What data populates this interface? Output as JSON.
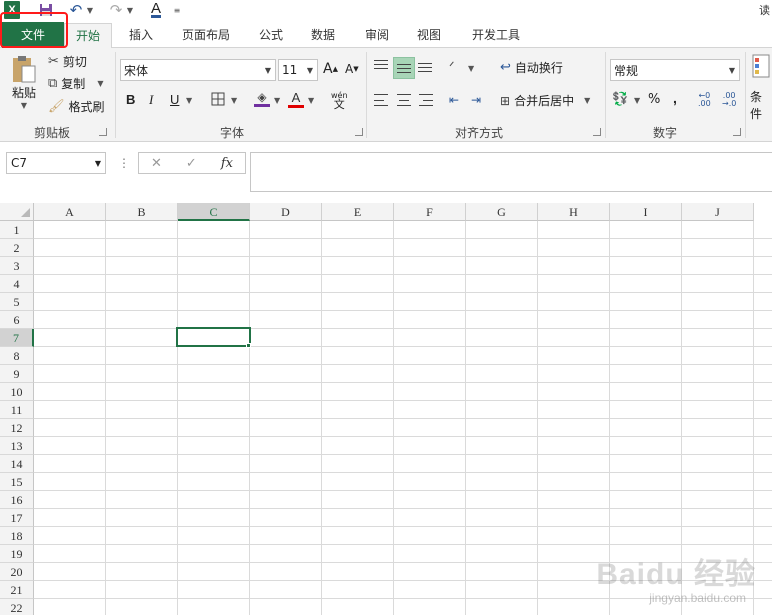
{
  "title_tail": "读",
  "tabs": [
    {
      "label": "文件"
    },
    {
      "label": "开始"
    },
    {
      "label": "插入"
    },
    {
      "label": "页面布局"
    },
    {
      "label": "公式"
    },
    {
      "label": "数据"
    },
    {
      "label": "审阅"
    },
    {
      "label": "视图"
    },
    {
      "label": "开发工具"
    }
  ],
  "clipboard": {
    "paste": "粘贴",
    "cut": "剪切",
    "copy": "复制",
    "format_painter": "格式刷",
    "group": "剪贴板"
  },
  "font": {
    "name": "宋体",
    "size": "11",
    "phonetic": "wén",
    "group": "字体"
  },
  "alignment": {
    "wrap_text": "自动换行",
    "merge_center": "合并后居中",
    "group": "对齐方式"
  },
  "number": {
    "format": "常规",
    "percent": "%",
    "comma": ",",
    "group": "数字"
  },
  "styles": {
    "conditional": "条件"
  },
  "formula_bar": {
    "name_box": "C7",
    "fx": "fx",
    "value": ""
  },
  "columns": [
    "A",
    "B",
    "C",
    "D",
    "E",
    "F",
    "G",
    "H",
    "I",
    "J"
  ],
  "rows": [
    "1",
    "2",
    "3",
    "4",
    "5",
    "6",
    "7",
    "8",
    "9",
    "10",
    "11",
    "12",
    "13",
    "14",
    "15",
    "16",
    "17",
    "18",
    "19",
    "20",
    "21",
    "22"
  ],
  "selected_cell": "C7",
  "watermark": {
    "big": "Baidu 经验",
    "small": "jingyan.baidu.com"
  },
  "colors": {
    "accent": "#217346",
    "highlight_outline": "#ff1a1a",
    "font_color_bar": "#e00000",
    "fill_color_bar": "#7030a0"
  }
}
